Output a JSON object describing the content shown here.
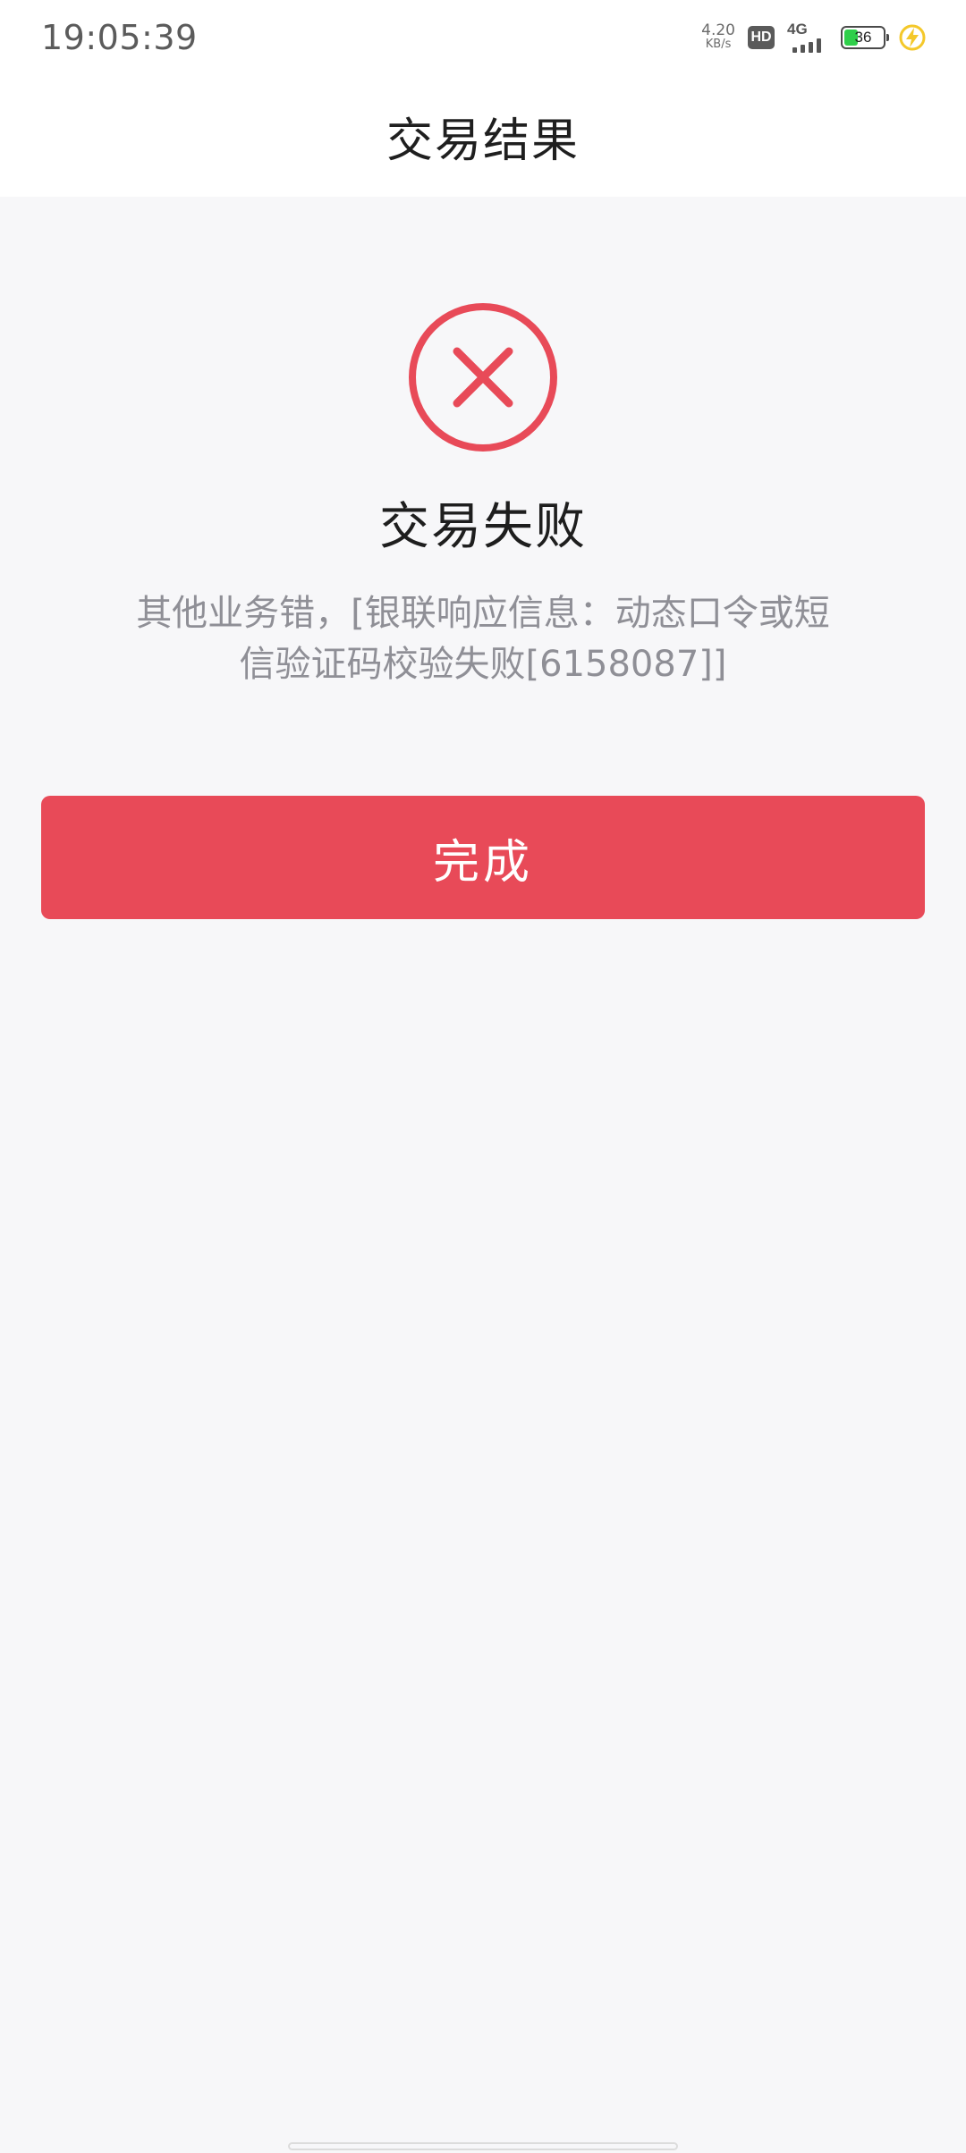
{
  "status_bar": {
    "time": "19:05:39",
    "net_speed_value": "4.20",
    "net_speed_unit": "KB/s",
    "hd_label": "HD",
    "network_type": "4G",
    "battery_percent": "36",
    "battery_level": 0.36,
    "battery_color": "#2fcf4a",
    "charging_icon": "lightning-icon"
  },
  "header": {
    "title": "交易结果"
  },
  "result": {
    "icon": "error-circle-icon",
    "icon_color": "#e84a58",
    "title": "交易失败",
    "message": "其他业务错，[银联响应信息：动态口令或短信验证码校验失败[6158087]]"
  },
  "actions": {
    "done_label": "完成",
    "done_color": "#e84a58"
  }
}
